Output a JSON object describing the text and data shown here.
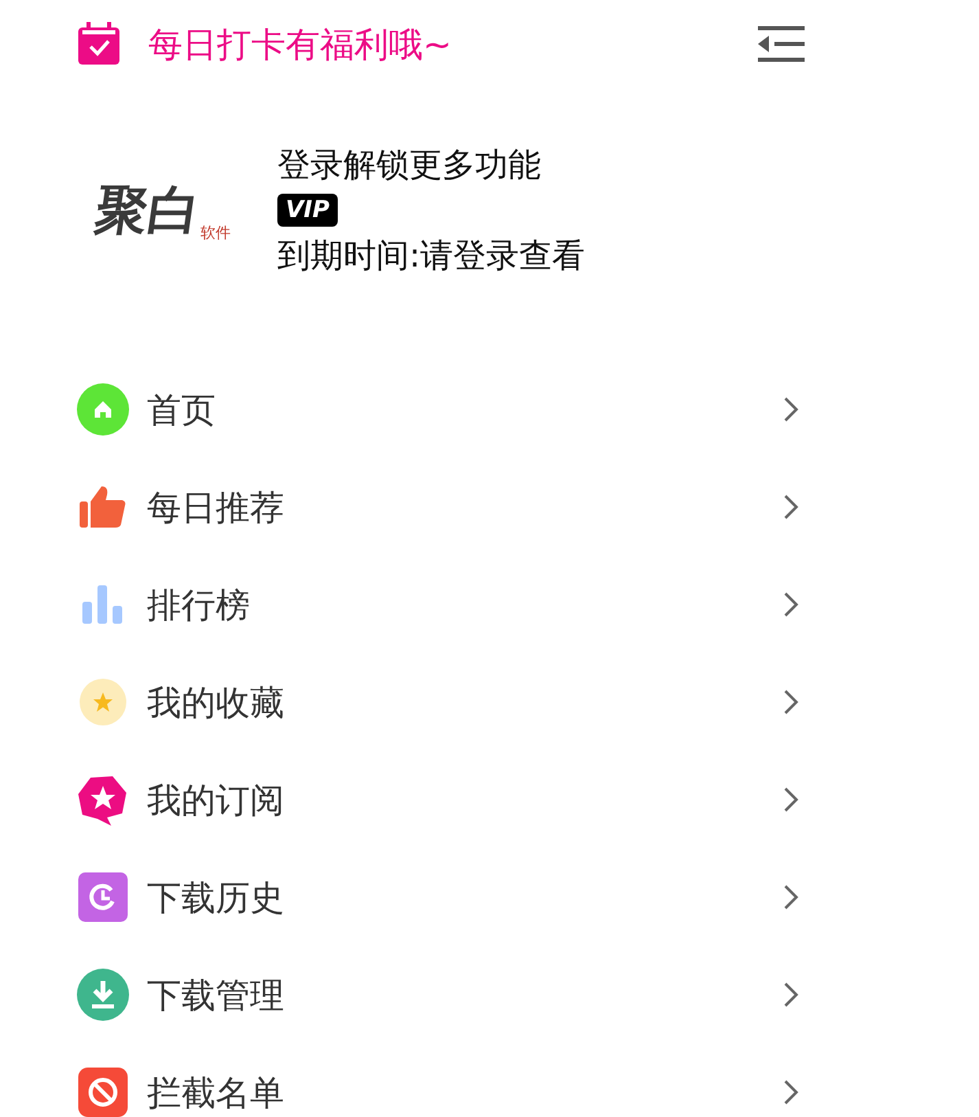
{
  "checkin": {
    "text": "每日打卡有福利哦~"
  },
  "profile": {
    "logo_main": "聚白",
    "logo_sub": "软件",
    "title": "登录解锁更多功能",
    "badge": "VIP",
    "expiry": "到期时间:请登录查看"
  },
  "menu": [
    {
      "label": "首页"
    },
    {
      "label": "每日推荐"
    },
    {
      "label": "排行榜"
    },
    {
      "label": "我的收藏"
    },
    {
      "label": "我的订阅"
    },
    {
      "label": "下载历史"
    },
    {
      "label": "下载管理"
    },
    {
      "label": "拦截名单"
    }
  ]
}
